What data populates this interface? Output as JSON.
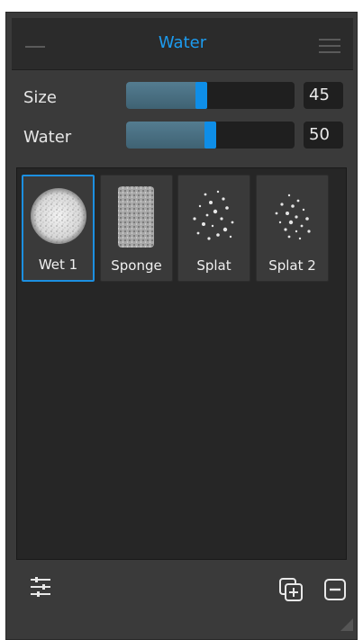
{
  "panel": {
    "title": "Water"
  },
  "sliders": [
    {
      "label": "Size",
      "value": "45",
      "level": 0.45
    },
    {
      "label": "Water",
      "value": "50",
      "level": 0.5
    }
  ],
  "brushes": [
    {
      "label": "Wet 1",
      "selected": true
    },
    {
      "label": "Sponge",
      "selected": false
    },
    {
      "label": "Splat",
      "selected": false
    },
    {
      "label": "Splat 2",
      "selected": false
    }
  ],
  "icons": {
    "menu": "hamburger-menu-icon",
    "minimize": "minimize-dash-icon",
    "adjust": "sliders-adjust-icon",
    "add": "duplicate-add-icon",
    "remove": "remove-minus-icon",
    "resize": "resize-grip-icon"
  },
  "colors": {
    "accent": "#1c9cf0",
    "panel_bg": "#3a3a3a",
    "well_bg": "#262626",
    "slider_fill": "#4b7183",
    "slider_thumb": "#0e8ee8"
  }
}
